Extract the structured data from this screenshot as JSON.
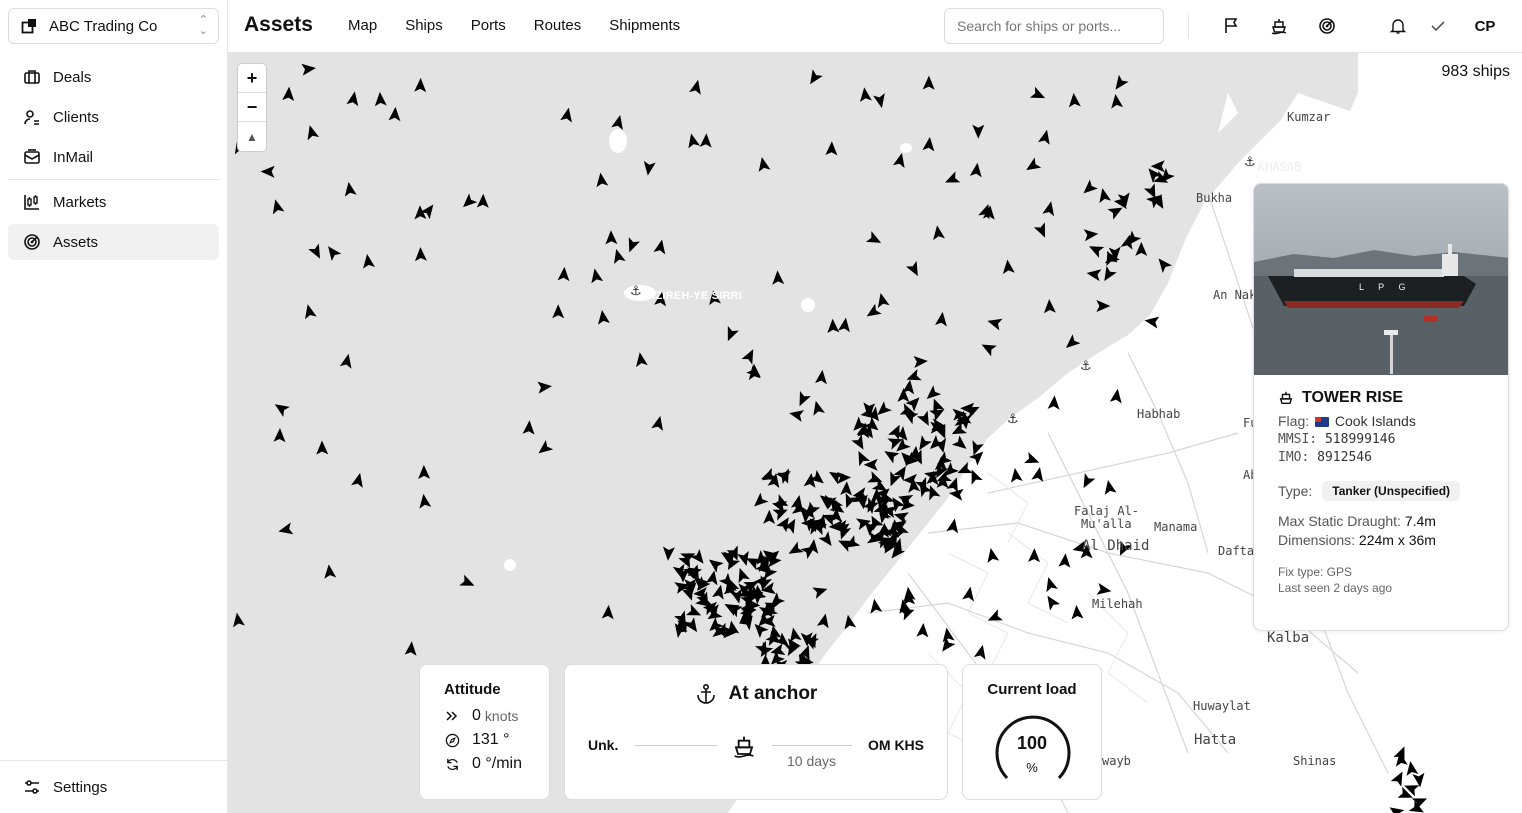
{
  "org": {
    "name": "ABC Trading Co"
  },
  "sidebar": {
    "items": [
      {
        "label": "Deals",
        "icon": "briefcase-icon"
      },
      {
        "label": "Clients",
        "icon": "user-icon"
      },
      {
        "label": "InMail",
        "icon": "mail-icon"
      },
      {
        "label": "Markets",
        "icon": "candlestick-icon"
      },
      {
        "label": "Assets",
        "icon": "radar-icon",
        "active": true
      }
    ],
    "settings_label": "Settings"
  },
  "header": {
    "title": "Assets",
    "tabs": [
      "Map",
      "Ships",
      "Ports",
      "Routes",
      "Shipments"
    ],
    "search_placeholder": "Search for ships or ports...",
    "avatar": "CP"
  },
  "map": {
    "ships_count": "983 ships",
    "zoom_in": "+",
    "zoom_out": "−",
    "labels": {
      "kumzar": "Kumzar",
      "khasab": "KHASAB",
      "bukha": "Bukha",
      "an_nakh": "An Nak",
      "sirri": "JAZIREH-YE SIRRI",
      "habhab": "Habhab",
      "fu": "Fu",
      "abadilah": "Abadilah",
      "falaj": "Falaj Al-",
      "mualla": "Mu'alla",
      "manama": "Manama",
      "aldhaid": "Al Dhaid",
      "daftah": "Daftah",
      "milehah": "Milehah",
      "kalba": "Kalba",
      "huwaylat": "Huwaylat",
      "hatta": "Hatta",
      "wayb": "wayb",
      "shinas": "Shinas"
    }
  },
  "ship_card": {
    "name": "TOWER RISE",
    "flag_label": "Flag:",
    "flag_country": "Cook Islands",
    "mmsi_label": "MMSI:",
    "mmsi": "518999146",
    "imo_label": "IMO:",
    "imo": "8912546",
    "type_label": "Type:",
    "type": "Tanker (Unspecified)",
    "draught_label": "Max Static Draught:",
    "draught": "7.4m",
    "dimensions_label": "Dimensions:",
    "dimensions": "224m x 36m",
    "fix_type": "Fix type: GPS",
    "last_seen": "Last seen 2 days ago",
    "hull_text": "L P G"
  },
  "attitude": {
    "title": "Attitude",
    "speed": "0",
    "speed_unit": "knots",
    "heading": "131 °",
    "rot": "0 °/min"
  },
  "status": {
    "title": "At anchor",
    "from": "Unk.",
    "to": "OM KHS",
    "duration": "10 days"
  },
  "load": {
    "title": "Current load",
    "value": "100",
    "value_fraction": 1.0,
    "unit": "%"
  }
}
